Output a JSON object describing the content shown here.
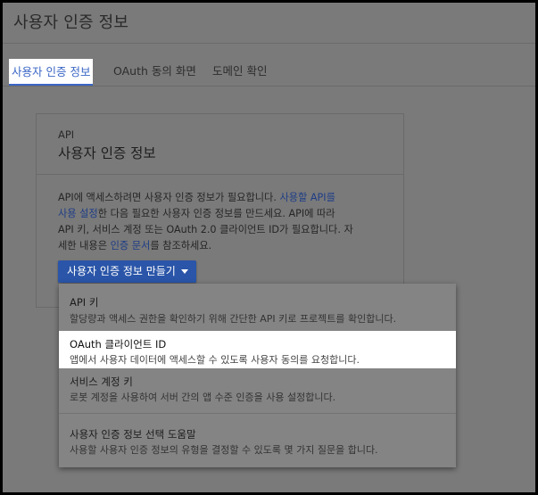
{
  "header": {
    "title": "사용자 인증 정보"
  },
  "tabs": [
    {
      "label": "사용자 인증 정보"
    },
    {
      "label": "OAuth 동의 화면"
    },
    {
      "label": "도메인 확인"
    }
  ],
  "card": {
    "eyebrow": "API",
    "title": "사용자 인증 정보",
    "body": {
      "line1_a": "API에 액세스하려면 사용자 인증 정보가 필요합니다. ",
      "line1_link": "사용할 API를",
      "line2_link": "사용 설정",
      "line2_b": "한 다음 필요한 사용자 인증 정보를 만드세요. API에 따라",
      "line3": "API 키, 서비스 계정 또는 OAuth 2.0 클라이언트 ID가 필요합니다. 자",
      "line4_a": "세한 내용은 ",
      "line4_link": "인증 문서",
      "line4_b": "를 참조하세요."
    }
  },
  "create_button": {
    "label": "사용자 인증 정보 만들기"
  },
  "menu": {
    "items": [
      {
        "title": "API 키",
        "desc": "할당량과 액세스 권한을 확인하기 위해 간단한 API 키로 프로젝트를 확인합니다."
      },
      {
        "title": "OAuth 클라이언트 ID",
        "desc": "앱에서 사용자 데이터에 액세스할 수 있도록 사용자 동의를 요청합니다."
      },
      {
        "title": "서비스 계정 키",
        "desc": "로봇 계정을 사용하여 서버 간의 앱 수준 인증을 사용 설정합니다."
      },
      {
        "title": "사용자 인증 정보 선택 도움말",
        "desc": "사용할 사용자 인증 정보의 유형을 결정할 수 있도록 몇 가지 질문을 합니다."
      }
    ]
  }
}
